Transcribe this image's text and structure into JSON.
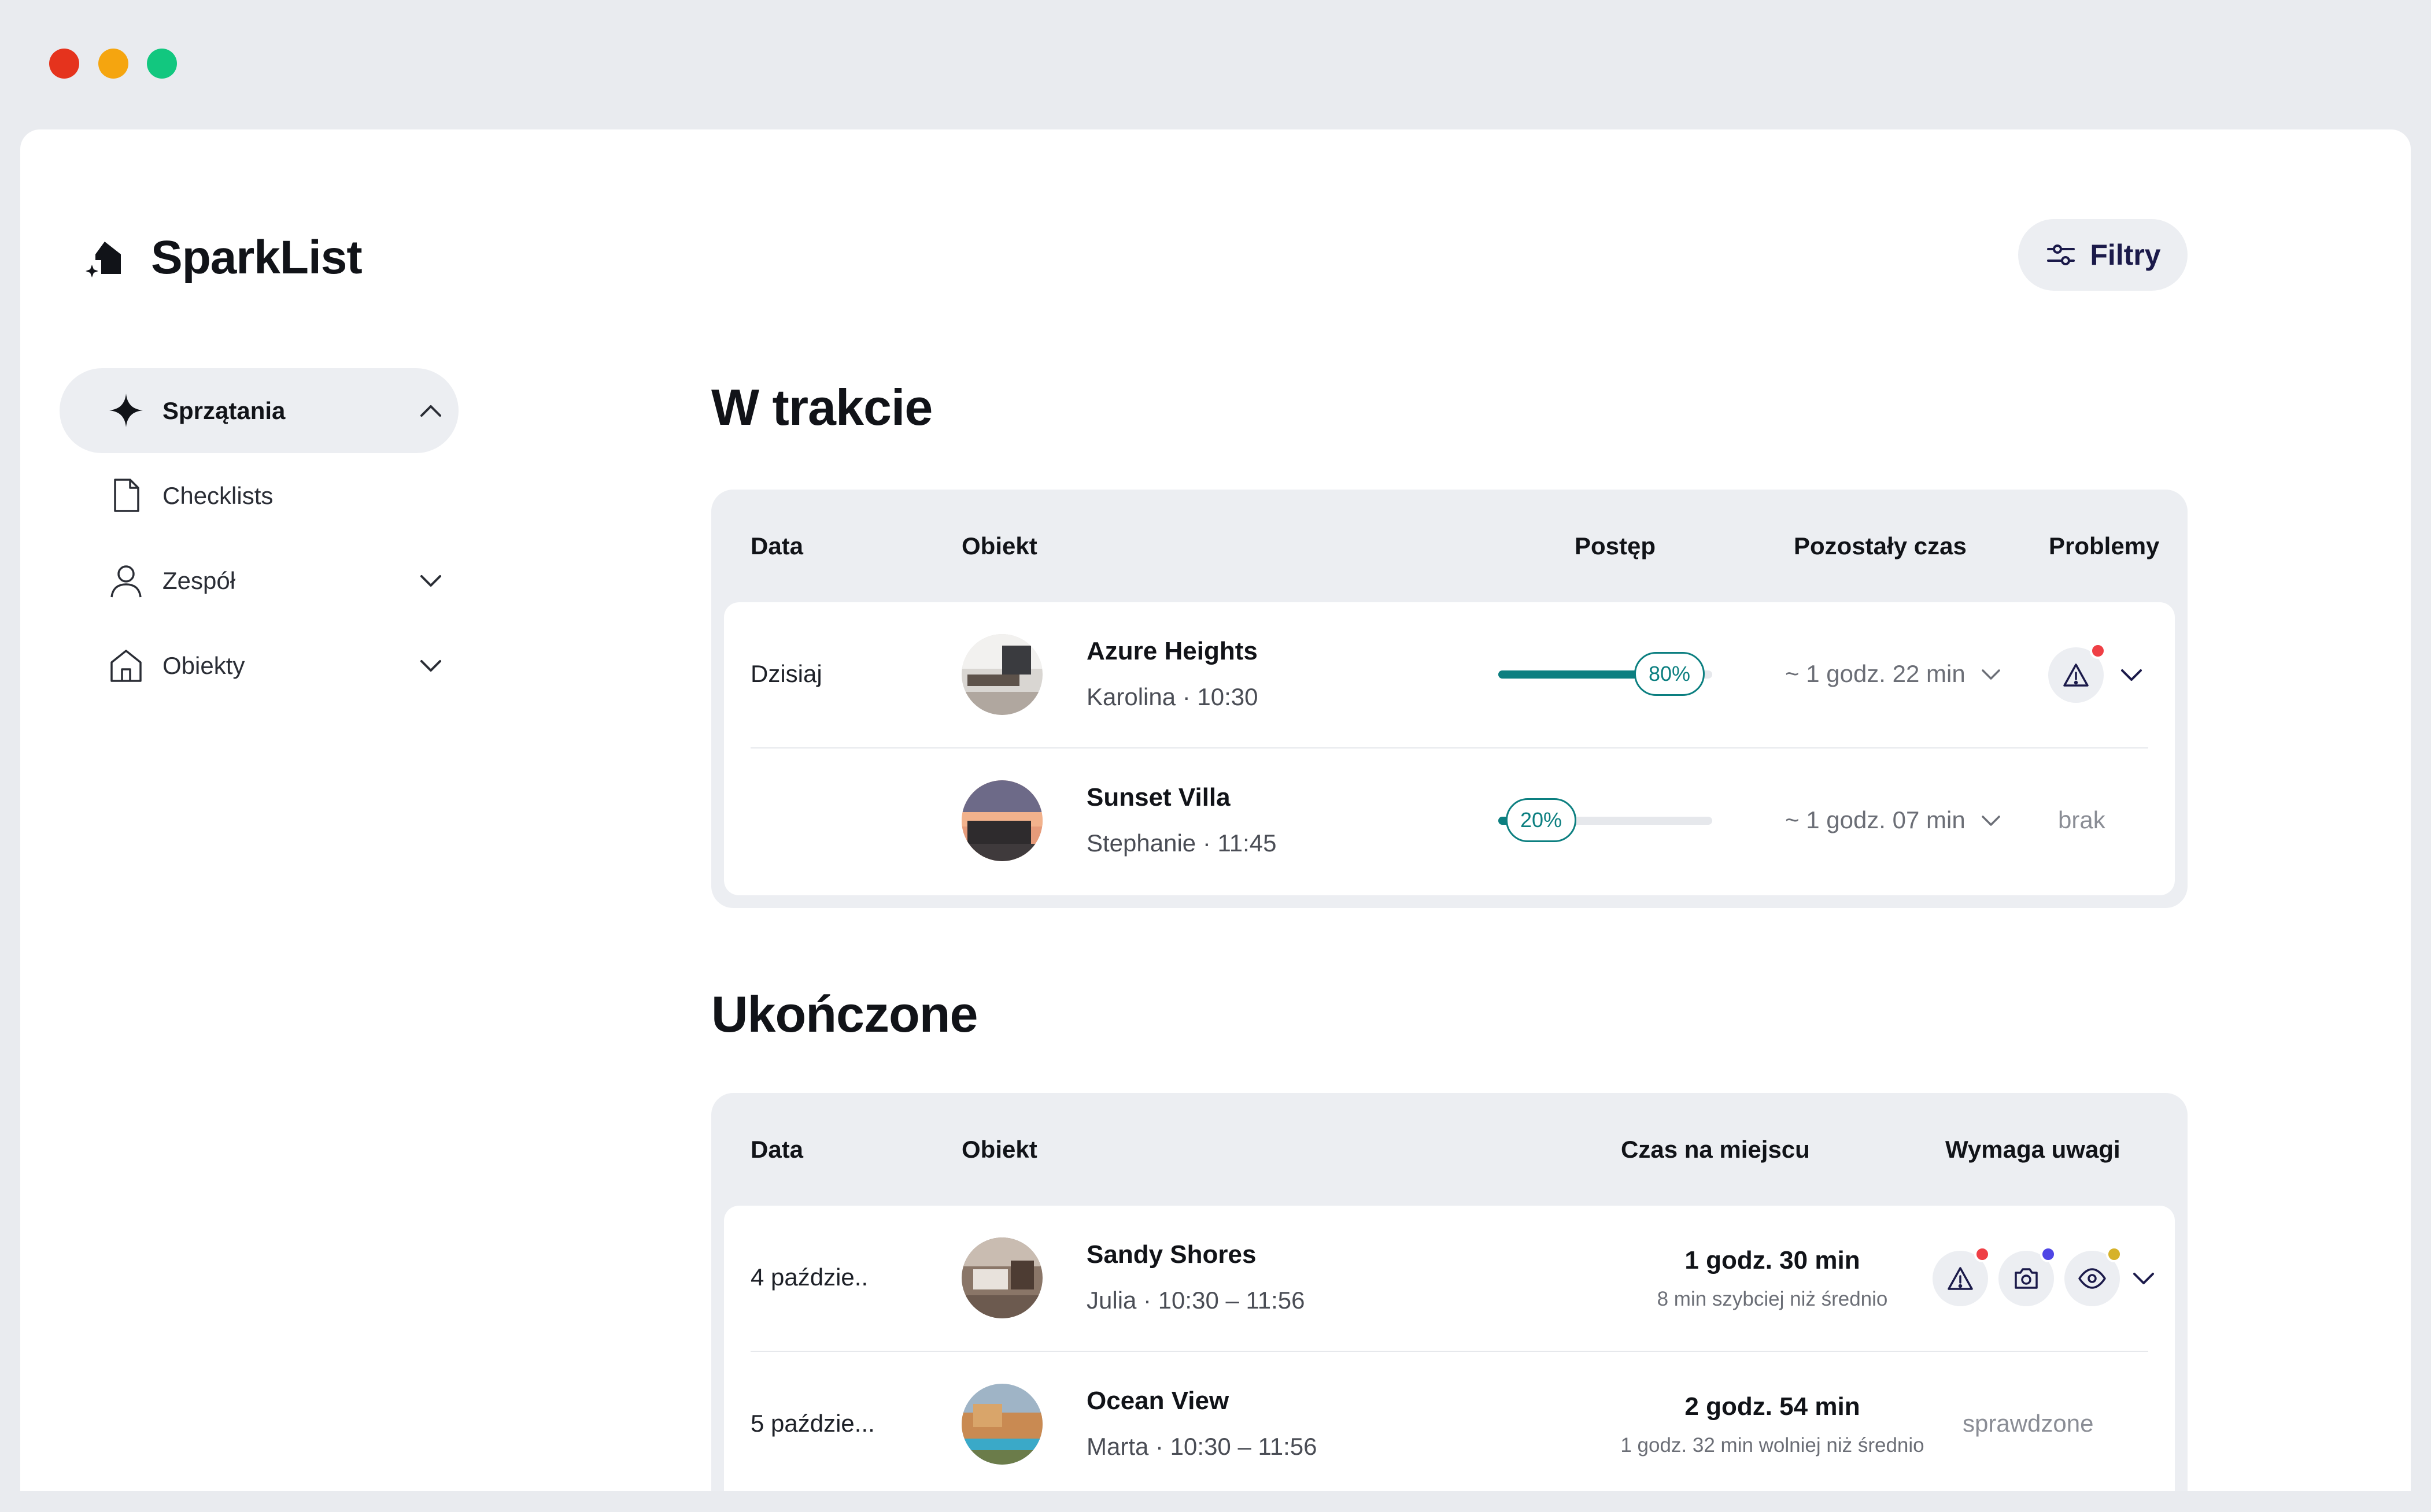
{
  "app": {
    "name": "SparkList"
  },
  "toolbar": {
    "filter_label": "Filtry"
  },
  "sidebar": {
    "items": [
      {
        "label": "Sprzątania",
        "active": true,
        "icon": "sparkle-icon",
        "expanded": true
      },
      {
        "label": "Checklists",
        "active": false,
        "icon": "document-icon"
      },
      {
        "label": "Zespół",
        "active": false,
        "icon": "user-icon",
        "expanded": false
      },
      {
        "label": "Obiekty",
        "active": false,
        "icon": "home-icon",
        "expanded": false
      }
    ]
  },
  "in_progress": {
    "title": "W trakcie",
    "columns": {
      "date": "Data",
      "property": "Obiekt",
      "progress": "Postęp",
      "remaining": "Pozostały czas",
      "issues": "Problemy"
    },
    "rows": [
      {
        "date": "Dzisiaj",
        "property": "Azure Heights",
        "cleaner_time": "Karolina · 10:30",
        "progress": 80,
        "progress_label": "80%",
        "remaining": "~ 1 godz. 22 min",
        "issues_label": ""
      },
      {
        "date": "",
        "property": "Sunset Villa",
        "cleaner_time": "Stephanie · 11:45",
        "progress": 20,
        "progress_label": "20%",
        "remaining": "~ 1 godz. 07 min",
        "issues_label": "brak"
      }
    ]
  },
  "completed": {
    "title": "Ukończone",
    "columns": {
      "date": "Data",
      "property": "Obiekt",
      "onsite": "Czas na miejscu",
      "attention": "Wymaga uwagi"
    },
    "rows": [
      {
        "date": "4 paździe..",
        "property": "Sandy Shores",
        "cleaner_time": "Julia · 10:30 – 11:56",
        "duration": "1 godz. 30 min",
        "comparison": "8 min szybciej niż średnio",
        "attention_label": ""
      },
      {
        "date": "5 paździe...",
        "property": "Ocean View",
        "cleaner_time": "Marta · 10:30 – 11:56",
        "duration": "2 godz. 54 min",
        "comparison": "1 godz. 32 min wolniej niż średnio",
        "attention_label": "sprawdzone"
      }
    ]
  },
  "colors": {
    "accent_teal": "#0c7f80",
    "dot_red": "#ef3f45",
    "dot_blue": "#4f46e5",
    "dot_yellow": "#d6b22a",
    "traffic_red": "#e5331d",
    "traffic_yellow": "#f5a50f",
    "traffic_green": "#12c77f"
  }
}
